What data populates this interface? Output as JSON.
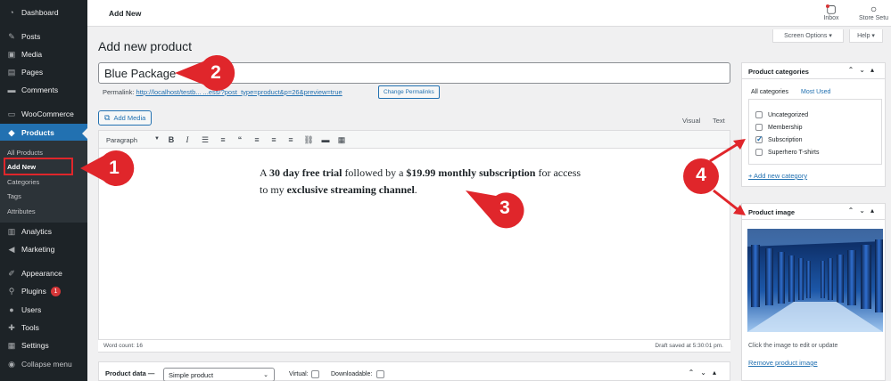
{
  "sidebar": {
    "items": [
      {
        "label": "Dashboard",
        "icon": "dashboard-icon"
      },
      {
        "label": "Posts",
        "icon": "pin-icon"
      },
      {
        "label": "Media",
        "icon": "media-icon"
      },
      {
        "label": "Pages",
        "icon": "page-icon"
      },
      {
        "label": "Comments",
        "icon": "comment-icon"
      },
      {
        "label": "WooCommerce",
        "icon": "woo-icon"
      },
      {
        "label": "Products",
        "icon": "box-icon"
      },
      {
        "label": "Analytics",
        "icon": "chart-icon"
      },
      {
        "label": "Marketing",
        "icon": "megaphone-icon"
      },
      {
        "label": "Appearance",
        "icon": "brush-icon"
      },
      {
        "label": "Plugins",
        "icon": "plug-icon"
      },
      {
        "label": "Users",
        "icon": "user-icon"
      },
      {
        "label": "Tools",
        "icon": "wrench-icon"
      },
      {
        "label": "Settings",
        "icon": "settings-icon"
      },
      {
        "label": "Collapse menu",
        "icon": "collapse-icon"
      }
    ],
    "products_sub": [
      "All Products",
      "Add New",
      "Categories",
      "Tags",
      "Attributes"
    ],
    "plugins_badge": "1"
  },
  "topbar": {
    "title": "Add New",
    "inbox_label": "Inbox",
    "store_label": "Store Setu"
  },
  "screen_options": "Screen Options ▾",
  "help": "Help ▾",
  "page_title": "Add new product",
  "title_value": "Blue Package",
  "permalink": {
    "label": "Permalink:",
    "url": "http://localhost/testb... ...ess/?post_type=product&p=26&preview=true",
    "button": "Change Permalinks"
  },
  "editor": {
    "add_media": "Add Media",
    "tab_visual": "Visual",
    "tab_text": "Text",
    "paragraph": "Paragraph",
    "content": {
      "a": "A ",
      "b1": "30 day free trial",
      "c": " followed by a ",
      "b2": "$19.99 monthly subscription",
      "d": " for access to my ",
      "b3": "exclusive streaming channel",
      "e": "."
    },
    "word_count": "Word count: 16",
    "draft_saved": "Draft saved at 5:30:01 pm."
  },
  "product_data": {
    "label": "Product data —",
    "type": "Simple product",
    "virtual": "Virtual:",
    "downloadable": "Downloadable:"
  },
  "categories": {
    "title": "Product categories",
    "tab_all": "All categories",
    "tab_used": "Most Used",
    "items": [
      {
        "label": "Uncategorized",
        "checked": false
      },
      {
        "label": "Membership",
        "checked": false
      },
      {
        "label": "Subscription",
        "checked": true
      },
      {
        "label": "Superhero T-shirts",
        "checked": false
      }
    ],
    "add_new": "+ Add new category"
  },
  "product_image": {
    "title": "Product image",
    "caption": "Click the image to edit or update",
    "remove": "Remove product image"
  },
  "annotations": [
    "1",
    "2",
    "3",
    "4"
  ],
  "colors": {
    "accent": "#2271b1",
    "sidebar": "#1d2327",
    "annotation": "#e0262b"
  }
}
